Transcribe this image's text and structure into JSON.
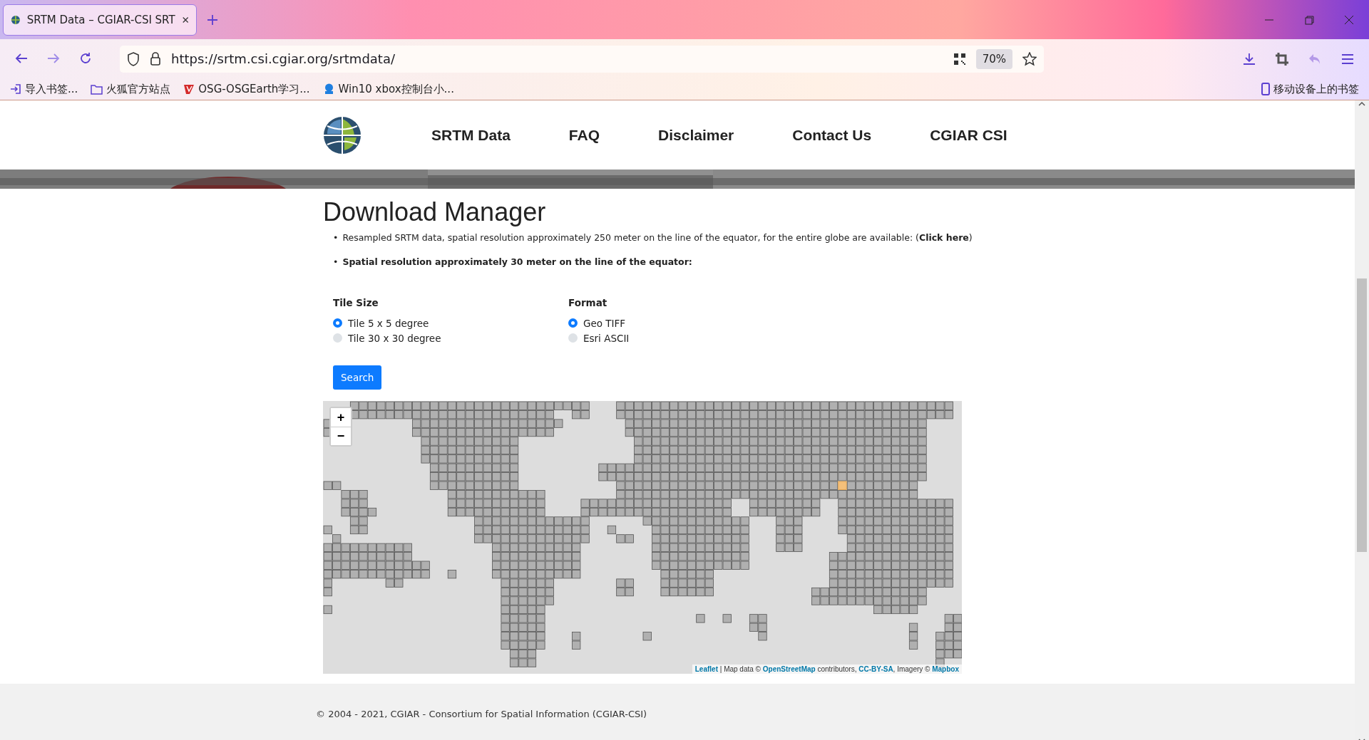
{
  "browser": {
    "tabs": [
      {
        "title": "SRTM Data – CGIAR-CSI SRT",
        "selected": true
      }
    ],
    "address": "https://srtm.csi.cgiar.org/srtmdata/",
    "zoom": "70%",
    "bookmarks": [
      {
        "label": "导入书签...",
        "kind": "import"
      },
      {
        "label": "火狐官方站点",
        "kind": "folder"
      },
      {
        "label": "OSG-OSGEarth学习...",
        "kind": "red"
      },
      {
        "label": "Win10 xbox控制台小...",
        "kind": "blue"
      }
    ],
    "mobile_bookmarks": "移动设备上的书签"
  },
  "nav": [
    {
      "label": "SRTM Data"
    },
    {
      "label": "FAQ"
    },
    {
      "label": "Disclaimer"
    },
    {
      "label": "Contact Us"
    },
    {
      "label": "CGIAR CSI"
    }
  ],
  "title": "Download Manager",
  "notes": [
    {
      "bullet": "•",
      "text": "Resampled SRTM data, spatial resolution approximately 250 meter on the line of the equator, for the entire globe are available: (",
      "link": "Click here",
      "after": ")",
      "bold": false
    },
    {
      "bullet": "•",
      "text": "Spatial resolution approximately 30 meter on the line of the equator:",
      "bold": true
    }
  ],
  "groups": [
    {
      "label": "Tile Size",
      "options": [
        {
          "label": "Tile 5 x 5 degree",
          "selected": true
        },
        {
          "label": "Tile 30 x 30 degree",
          "selected": false
        }
      ]
    },
    {
      "label": "Format",
      "options": [
        {
          "label": "Geo TIFF",
          "selected": true
        },
        {
          "label": "Esri ASCII",
          "selected": false
        }
      ]
    }
  ],
  "search_button": "Search",
  "map": {
    "zoom_in": "+",
    "zoom_out": "−",
    "attribution": [
      {
        "text": "Leaflet",
        "link": true
      },
      {
        "text": " | Map data © ",
        "link": false
      },
      {
        "text": "OpenStreetMap",
        "link": true
      },
      {
        "text": " contributors, ",
        "link": false
      },
      {
        "text": "CC-BY-SA",
        "link": true
      },
      {
        "text": ", Imagery © ",
        "link": false
      },
      {
        "text": "Mapbox",
        "link": true
      }
    ]
  },
  "footer": "© 2004 - 2021, CGIAR - Consortium for Spatial Information (CGIAR-CSI)"
}
